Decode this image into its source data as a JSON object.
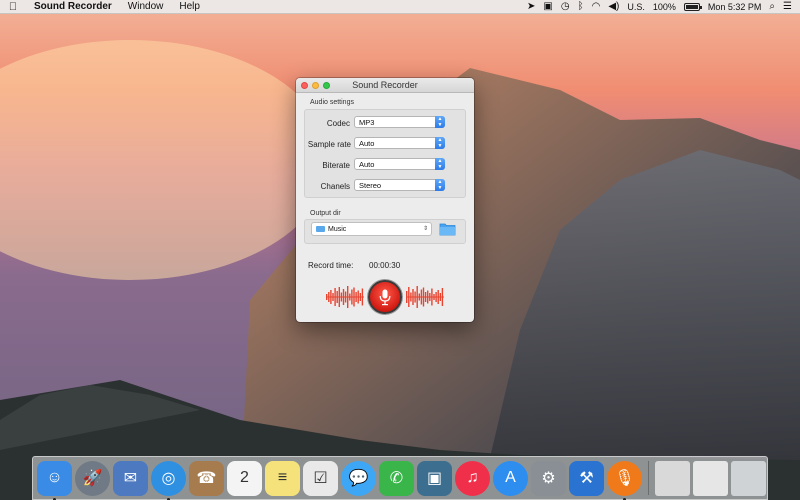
{
  "menubar": {
    "app_name": "Sound Recorder",
    "menus": [
      "Window",
      "Help"
    ],
    "input_source": "U.S.",
    "battery": "100%",
    "battery_level": 1.0,
    "clock": "Mon 5:32 PM"
  },
  "window": {
    "title": "Sound Recorder",
    "audio_settings": {
      "label": "Audio settings",
      "codec_label": "Codec",
      "codec_value": "MP3",
      "sample_rate_label": "Sample rate",
      "sample_rate_value": "Auto",
      "biterate_label": "Biterate",
      "biterate_value": "Auto",
      "chanels_label": "Chanels",
      "chanels_value": "Stereo"
    },
    "output_dir": {
      "label": "Output dir",
      "value": "Music"
    },
    "record": {
      "label": "Record time:",
      "time": "00:00:30"
    }
  },
  "colors": {
    "accent": "#2d7be8",
    "record_red": "#d11a12",
    "wave_red": "#e8432e"
  },
  "dock": {
    "items": [
      {
        "name": "finder-icon",
        "color": "#3a8be6",
        "glyph": "☺",
        "running": true
      },
      {
        "name": "launchpad-icon",
        "color": "#6f7a86",
        "glyph": "🚀",
        "running": false
      },
      {
        "name": "mail-stamp-icon",
        "color": "#4d79c0",
        "glyph": "✉",
        "running": false
      },
      {
        "name": "safari-icon",
        "color": "#2f8fe0",
        "glyph": "◎",
        "running": true
      },
      {
        "name": "contacts-icon",
        "color": "#a67c4f",
        "glyph": "☎",
        "running": false
      },
      {
        "name": "calendar-icon",
        "color": "#f4f4f4",
        "glyph": "2",
        "running": false
      },
      {
        "name": "notes-icon",
        "color": "#f5e27a",
        "glyph": "≡",
        "running": false
      },
      {
        "name": "reminders-icon",
        "color": "#e9e9e9",
        "glyph": "☑",
        "running": false
      },
      {
        "name": "messages-icon",
        "color": "#3da6f5",
        "glyph": "💬",
        "running": false
      },
      {
        "name": "facetime-icon",
        "color": "#39b54a",
        "glyph": "✆",
        "running": false
      },
      {
        "name": "photos-icon",
        "color": "#3c6e8f",
        "glyph": "▣",
        "running": false
      },
      {
        "name": "itunes-icon",
        "color": "#f0304a",
        "glyph": "♫",
        "running": false
      },
      {
        "name": "app-store-icon",
        "color": "#2d8ef0",
        "glyph": "A",
        "running": false
      },
      {
        "name": "system-preferences-icon",
        "color": "#8a8f96",
        "glyph": "⚙",
        "running": false
      },
      {
        "name": "xcode-icon",
        "color": "#2b73d0",
        "glyph": "⚒",
        "running": false
      },
      {
        "name": "sound-recorder-icon",
        "color": "#f07a1a",
        "glyph": "🎙",
        "running": true
      }
    ],
    "right_items": [
      {
        "name": "downloads-stack-icon",
        "color": "#d9d9d9"
      },
      {
        "name": "documents-stack-icon",
        "color": "#e6e6e6"
      },
      {
        "name": "trash-icon",
        "color": "#cfd3d6"
      }
    ]
  }
}
